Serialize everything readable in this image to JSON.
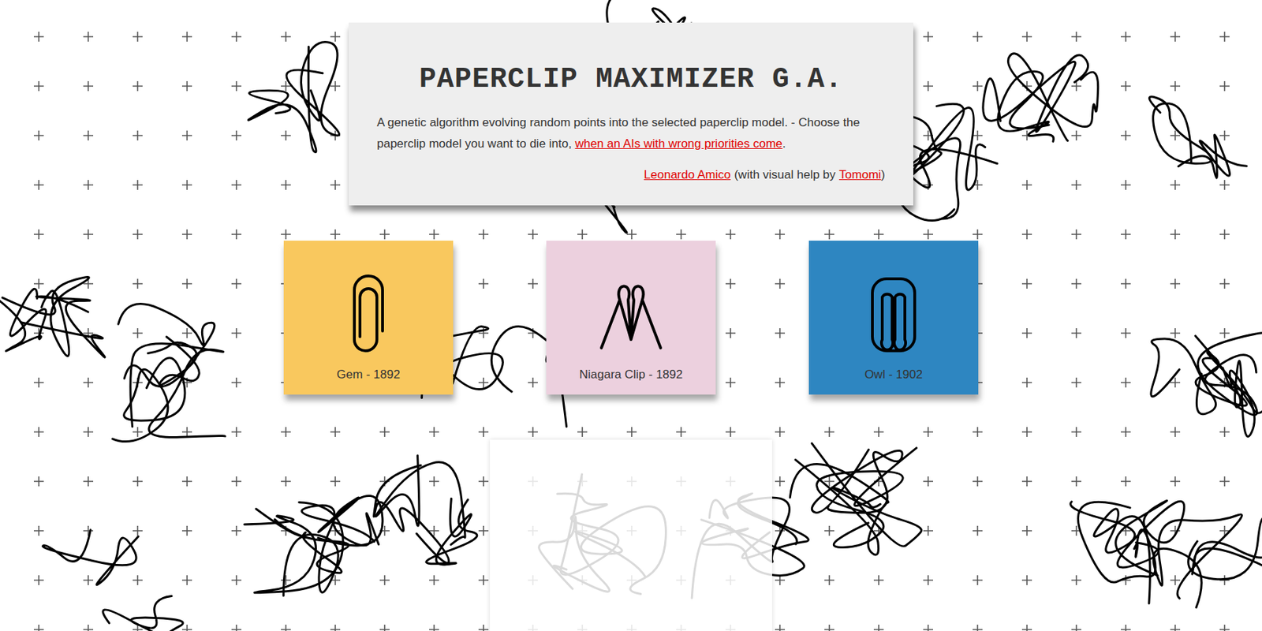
{
  "header": {
    "title": "PAPERCLIP MAXIMIZER G.A.",
    "description": "A genetic algorithm evolving random points into the selected paperclip model. - Choose the paperclip model you want to die into, ",
    "link": "when an AIs with wrong priorities come",
    "period": ".",
    "author": "Leonardo Amico",
    "credit_middle": "(with visual help by",
    "helper": "Tomomi",
    "credit_end": ")"
  },
  "models": [
    {
      "label": "Gem - 1892",
      "color": "#f9c85e",
      "kind": "gem"
    },
    {
      "label": "Niagara Clip - 1892",
      "color": "#ecd0de",
      "kind": "niagara"
    },
    {
      "label": "Owl - 1902",
      "color": "#2e86c1",
      "kind": "owl"
    }
  ]
}
